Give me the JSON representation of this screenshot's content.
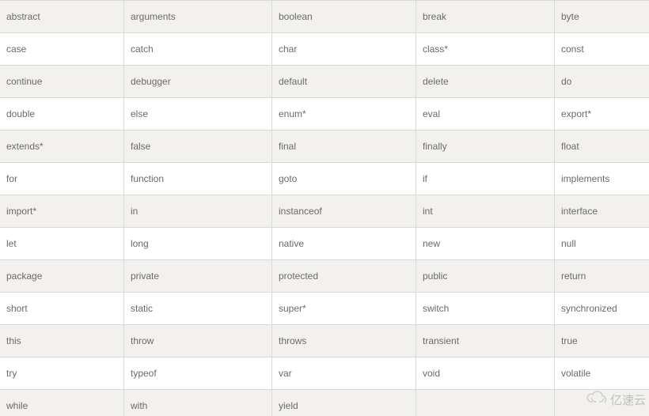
{
  "keywords": [
    [
      "abstract",
      "arguments",
      "boolean",
      "break",
      "byte"
    ],
    [
      "case",
      "catch",
      "char",
      "class*",
      "const"
    ],
    [
      "continue",
      "debugger",
      "default",
      "delete",
      "do"
    ],
    [
      "double",
      "else",
      "enum*",
      "eval",
      "export*"
    ],
    [
      "extends*",
      "false",
      "final",
      "finally",
      "float"
    ],
    [
      "for",
      "function",
      "goto",
      "if",
      "implements"
    ],
    [
      "import*",
      "in",
      "instanceof",
      "int",
      "interface"
    ],
    [
      "let",
      "long",
      "native",
      "new",
      "null"
    ],
    [
      "package",
      "private",
      "protected",
      "public",
      "return"
    ],
    [
      "short",
      "static",
      "super*",
      "switch",
      "synchronized"
    ],
    [
      "this",
      "throw",
      "throws",
      "transient",
      "true"
    ],
    [
      "try",
      "typeof",
      "var",
      "void",
      "volatile"
    ],
    [
      "while",
      "with",
      "yield",
      "",
      ""
    ]
  ],
  "watermark": {
    "text": "亿速云"
  }
}
